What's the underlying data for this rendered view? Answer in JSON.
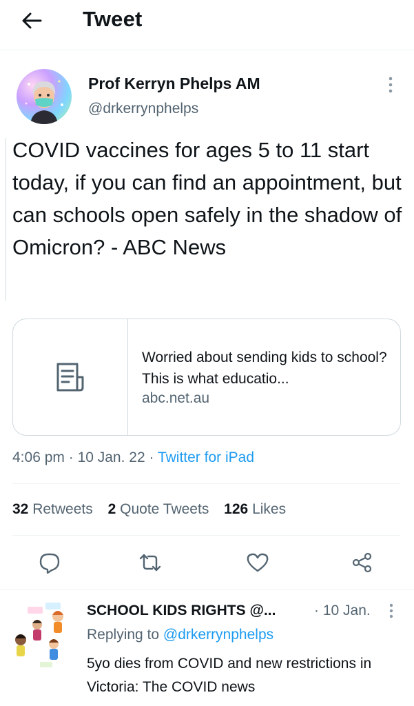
{
  "header": {
    "title": "Tweet",
    "back_icon": "arrow-left-icon"
  },
  "author": {
    "name": "Prof Kerryn Phelps AM",
    "handle": "@drkerrynphelps"
  },
  "tweet": {
    "text": "COVID vaccines for ages 5 to 11 start today, if you can find an appointment,  but can schools open safely in the shadow of Omicron? - ABC News"
  },
  "card": {
    "title": "Worried about sending kids to school? This is what educatio...",
    "domain": "abc.net.au",
    "icon": "article-icon"
  },
  "meta": {
    "time": "4:06 pm",
    "sep1": " · ",
    "date": "10 Jan. 22",
    "sep2": " · ",
    "source": "Twitter for iPad"
  },
  "stats": {
    "retweets_count": "32",
    "retweets_label": "Retweets",
    "quotes_count": "2",
    "quotes_label": "Quote Tweets",
    "likes_count": "126",
    "likes_label": "Likes"
  },
  "actions": [
    "reply-icon",
    "retweet-icon",
    "like-icon",
    "share-icon"
  ],
  "reply": {
    "name": "SCHOOL KIDS RIGHTS @...",
    "time": "· 10 Jan.",
    "replying_prefix": "Replying to ",
    "replying_handle": "@drkerrynphelps",
    "text": "5yo dies from COVID and new restrictions in Victoria: The COVID news"
  },
  "colors": {
    "accent": "#1d9bf0",
    "text": "#0f1419",
    "secondary": "#536471",
    "border": "#cfd9de"
  }
}
